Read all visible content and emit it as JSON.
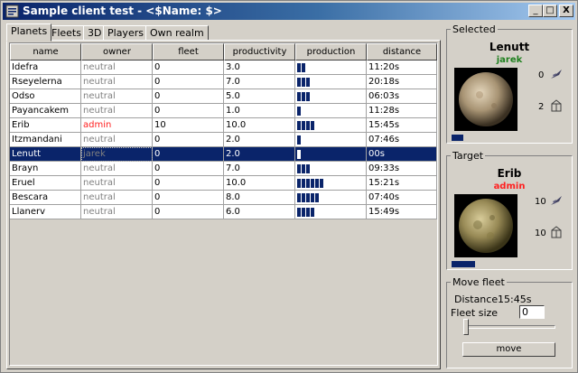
{
  "window": {
    "title": "Sample client test - <$Name:  $>",
    "min_label": "_",
    "max_label": "□",
    "close_label": "X"
  },
  "tabs": [
    {
      "label": "Planets",
      "active": true
    },
    {
      "label": "Fleets",
      "active": false
    },
    {
      "label": "3D",
      "active": false
    },
    {
      "label": "Players",
      "active": false
    },
    {
      "label": "Own realm",
      "active": false
    }
  ],
  "table": {
    "columns": [
      "name",
      "owner",
      "fleet",
      "productivity",
      "production",
      "distance"
    ],
    "rows": [
      {
        "name": "Idefra",
        "owner": "neutral",
        "fleet": "0",
        "productivity": "3.0",
        "production_level": 2,
        "distance": "11:20s"
      },
      {
        "name": "Rseyelerna",
        "owner": "neutral",
        "fleet": "0",
        "productivity": "7.0",
        "production_level": 3,
        "distance": "20:18s"
      },
      {
        "name": "Odso",
        "owner": "neutral",
        "fleet": "0",
        "productivity": "5.0",
        "production_level": 3,
        "distance": "06:03s"
      },
      {
        "name": "Payancakem",
        "owner": "neutral",
        "fleet": "0",
        "productivity": "1.0",
        "production_level": 1,
        "distance": "11:28s"
      },
      {
        "name": "Erib",
        "owner": "admin",
        "fleet": "10",
        "productivity": "10.0",
        "production_level": 4,
        "distance": "15:45s"
      },
      {
        "name": "Itzmandani",
        "owner": "neutral",
        "fleet": "0",
        "productivity": "2.0",
        "production_level": 1,
        "distance": "07:46s"
      },
      {
        "name": "Lenutt",
        "owner": "jarek",
        "fleet": "0",
        "productivity": "2.0",
        "production_level": 1,
        "distance": "00s",
        "selected": true
      },
      {
        "name": "Brayn",
        "owner": "neutral",
        "fleet": "0",
        "productivity": "7.0",
        "production_level": 3,
        "distance": "09:33s"
      },
      {
        "name": "Eruel",
        "owner": "neutral",
        "fleet": "0",
        "productivity": "10.0",
        "production_level": 6,
        "distance": "15:21s"
      },
      {
        "name": "Bescara",
        "owner": "neutral",
        "fleet": "0",
        "productivity": "8.0",
        "production_level": 5,
        "distance": "07:40s"
      },
      {
        "name": "Llanerv",
        "owner": "neutral",
        "fleet": "0",
        "productivity": "6.0",
        "production_level": 4,
        "distance": "15:49s"
      }
    ]
  },
  "selected": {
    "legend": "Selected",
    "name": "Lenutt",
    "owner": "jarek",
    "owner_color": "#208020",
    "ships": "0",
    "defense": "2",
    "production_fraction": 0.1
  },
  "target": {
    "legend": "Target",
    "name": "Erib",
    "owner": "admin",
    "owner_color": "#ff2020",
    "ships": "10",
    "defense": "10",
    "production_fraction": 0.2
  },
  "move_fleet": {
    "legend": "Move fleet",
    "distance_label": "Distance",
    "distance_value": "15:45s",
    "fleet_size_label": "Fleet size",
    "fleet_size_value": "0",
    "slider_fraction": 0.0,
    "move_label": "move"
  },
  "colors": {
    "selection": "#0a246a",
    "neutral": "#808080",
    "admin": "#ff2020",
    "jarek": "#208020"
  }
}
